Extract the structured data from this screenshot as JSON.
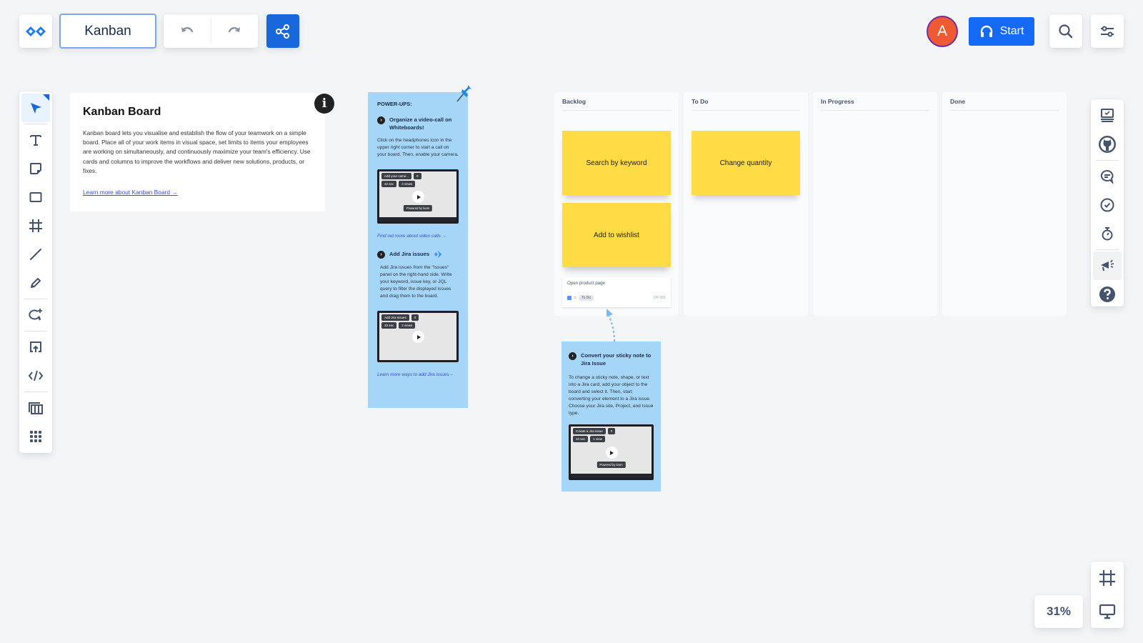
{
  "header": {
    "board_title": "Kanban",
    "undo_label": "Undo",
    "redo_label": "Redo",
    "share_label": "Share",
    "avatar_initial": "A",
    "start_label": "Start",
    "search_label": "Search",
    "settings_label": "Settings"
  },
  "colors": {
    "primary": "#1868db",
    "start_button": "#1469f5",
    "avatar": "#ee5a32",
    "sticky": "#ffdb45",
    "powerup_card": "#a5d5f7"
  },
  "left_toolbar": {
    "tools": [
      {
        "name": "select",
        "icon": "cursor-icon",
        "active": true
      },
      {
        "name": "text",
        "icon": "text-icon"
      },
      {
        "name": "sticky-note",
        "icon": "sticky-note-icon"
      },
      {
        "name": "shape",
        "icon": "rectangle-icon"
      },
      {
        "name": "frame",
        "icon": "frame-icon"
      },
      {
        "name": "line",
        "icon": "line-icon"
      },
      {
        "name": "pen",
        "icon": "pencil-icon"
      },
      {
        "name": "comment",
        "icon": "comment-add-icon"
      },
      {
        "name": "upload",
        "icon": "upload-icon"
      },
      {
        "name": "embed",
        "icon": "code-icon"
      },
      {
        "name": "templates",
        "icon": "columns-icon"
      },
      {
        "name": "more-apps",
        "icon": "apps-grid-icon"
      }
    ]
  },
  "right_toolbar": {
    "tools": [
      {
        "name": "jira-issues",
        "icon": "issues-panel-icon"
      },
      {
        "name": "github",
        "icon": "github-icon"
      },
      {
        "name": "comments",
        "icon": "comments-icon"
      },
      {
        "name": "tasks",
        "icon": "check-circle-icon"
      },
      {
        "name": "timer",
        "icon": "stopwatch-icon"
      },
      {
        "name": "announcements",
        "icon": "megaphone-icon",
        "active": true
      },
      {
        "name": "help",
        "icon": "help-icon"
      }
    ]
  },
  "zoom": {
    "level": "31%"
  },
  "view_tools": [
    {
      "name": "fit-frame",
      "icon": "frame-icon"
    },
    {
      "name": "present",
      "icon": "monitor-icon"
    }
  ],
  "info_card": {
    "title": "Kanban Board",
    "body": "Kanban board lets you visualise and establish the flow of your teamwork on a simple board. Place all of your work items in visual space, set limits to items your employees are working on simultaneously, and continuously maximize your team's efficiency. Use cards and columns to improve the workflows and deliver new solutions, products, or fixes.",
    "link": "Learn more about Kanban Board →",
    "badge": "i"
  },
  "powerups": {
    "heading": "POWER-UPS:",
    "sections": [
      {
        "title": "Organize a video-call on Whiteboards!",
        "body": "Click on the headphones icon in the upper right corner to start a call on your board. Then, enable your camera.",
        "video": {
          "title": "Add your came...",
          "comments": "0",
          "duration": "42 sec",
          "views": "3 views",
          "powered_by": "Powered by loom"
        },
        "link": "Find out more about video calls →"
      },
      {
        "title": "Add Jira issues",
        "body": "Add Jira issues from the \"Issues\" panel on the right-hand side. Write your keyword, issue key, or JQL query to filter the displayed issues and drag them to the board.",
        "video": {
          "title": "Add Jira Issues",
          "comments": "0",
          "duration": "33 sec",
          "views": "2 views"
        },
        "link": "Learn more ways to add Jira issues→"
      }
    ]
  },
  "convert_card": {
    "title": "Convert your sticky note to Jira Issue",
    "body": "To change a sticky note, shape, or text into a Jira card, add your object to the board and select it. Then, start converting your element to a Jira issue. Choose your Jira site, Project, and Issue type.",
    "video": {
      "title": "Create a Jira Issue",
      "comments": "0",
      "duration": "34 sec",
      "views": "1 view",
      "powered_by": "Powered by loom"
    }
  },
  "kanban": {
    "columns": [
      {
        "title": "Backlog",
        "stickies": [
          "Search by keyword",
          "Add to wishlist"
        ],
        "jira_card": {
          "summary": "Open product page",
          "status": "To Do",
          "key": "DP-301"
        }
      },
      {
        "title": "To Do",
        "stickies": [
          "Change quantity"
        ]
      },
      {
        "title": "In Progress",
        "stickies": []
      },
      {
        "title": "Done",
        "stickies": []
      }
    ]
  }
}
